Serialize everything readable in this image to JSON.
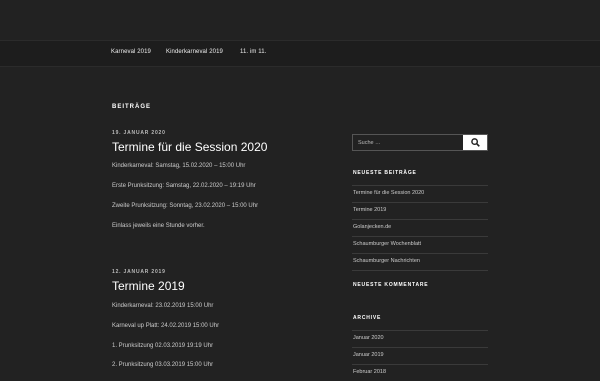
{
  "nav": {
    "items": [
      "Karneval 2019",
      "Kinderkarneval 2019",
      "11. im 11."
    ]
  },
  "main": {
    "heading": "BEITRÄGE",
    "posts": [
      {
        "date": "19. JANUAR 2020",
        "title": "Termine für die Session 2020",
        "lines": [
          "Kinderkarneval: Samstag, 15.02.2020 – 15:00 Uhr",
          "Erste Prunksitzung: Samstag, 22.02.2020 – 19:19 Uhr",
          "Zweite Prunksitzung: Sonntag, 23.02.2020 – 15:00 Uhr",
          "Einlass jeweils eine Stunde vorher."
        ]
      },
      {
        "date": "12. JANUAR 2019",
        "title": "Termine 2019",
        "lines": [
          "Kinderkarneval: 23.02.2019 15:00 Uhr",
          "Karneval up Platt: 24.02.2019 15:00 Uhr",
          "1. Prunksitzung 02.03.2019 19:19 Uhr",
          "2. Prunksitzung 03.03.2019 15:00 Uhr"
        ]
      }
    ]
  },
  "sidebar": {
    "search": {
      "placeholder": "Suche …",
      "icon": "search-icon"
    },
    "recent_posts": {
      "title": "NEUESTE BEITRÄGE",
      "items": [
        "Termine für die Session 2020",
        "Termine 2019",
        "Golanjecken.de",
        "Schaumburger Wochenblatt",
        "Schaumburger Nachrichten"
      ]
    },
    "recent_comments": {
      "title": "NEUESTE KOMMENTARE"
    },
    "archive": {
      "title": "ARCHIVE",
      "items": [
        "Januar 2020",
        "Januar 2019",
        "Februar 2018"
      ]
    }
  },
  "colors": {
    "background": "#222222",
    "text": "#dddddd",
    "search_button": "#ffffff"
  }
}
